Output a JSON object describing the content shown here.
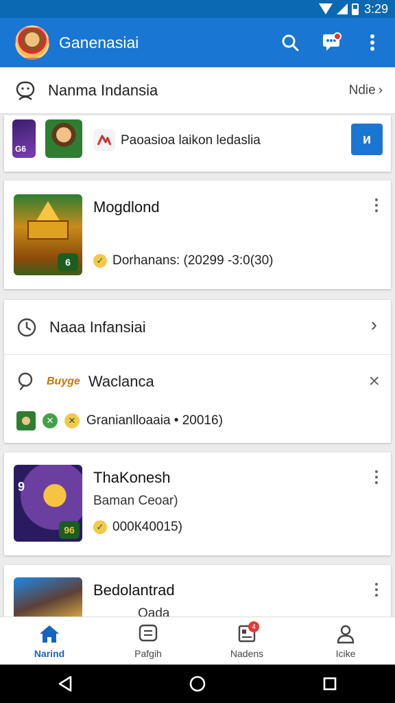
{
  "status_bar": {
    "time": "3:29"
  },
  "app_bar": {
    "title": "Ganenasiai",
    "actions": [
      "search-icon",
      "chat-icon",
      "more-vert-icon"
    ]
  },
  "account_row": {
    "label": "Nanma Indansia",
    "more": "Ndie"
  },
  "promo": {
    "text": "Paoasioa laikon ledaslia",
    "button": "и"
  },
  "games": [
    {
      "title": "Mogdlond",
      "meta": "Dorhanans: (20299 -3:0(30)",
      "thumb_badge": "6"
    },
    {
      "title": "ThaKonesh",
      "subtitle": "Baman Ceoar)",
      "meta": "000К40015)",
      "thumb_badge": "96"
    },
    {
      "title": "Bedolantrad",
      "subtitle": "Oada"
    }
  ],
  "history_card": {
    "row_label": "Naaa Infansiai",
    "search_label": "Waclanca",
    "search_tag": "Buyge",
    "meta": "Granianlloaaia • 20016)"
  },
  "bottom_nav": [
    {
      "label": "Narind",
      "icon": "home-icon",
      "active": true
    },
    {
      "label": "Pafgih",
      "icon": "message-icon"
    },
    {
      "label": "Nadens",
      "icon": "news-icon",
      "badge": "4"
    },
    {
      "label": "Icike",
      "icon": "profile-icon"
    }
  ],
  "colors": {
    "primary": "#1976d2",
    "status_bar": "#0b68b3",
    "accent": "#e53935"
  }
}
